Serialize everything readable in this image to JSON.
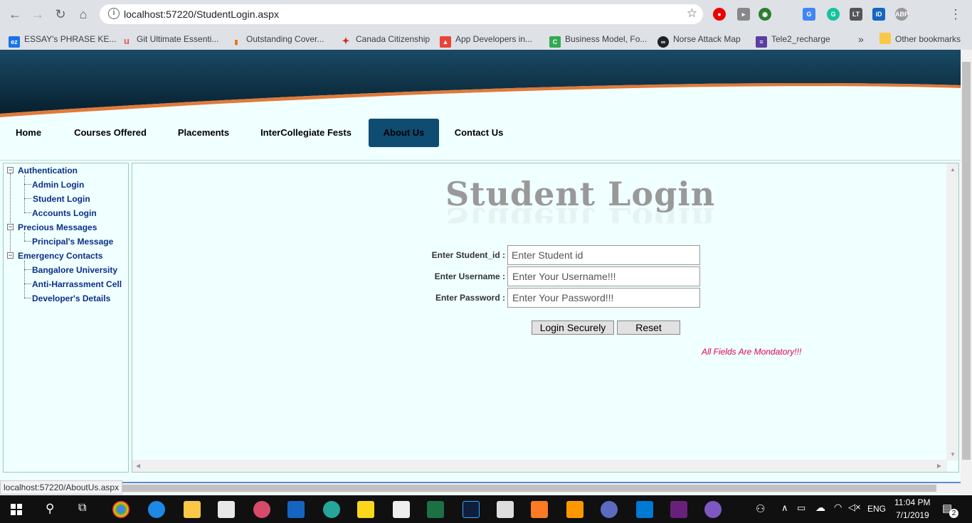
{
  "browser": {
    "url": "localhost:57220/StudentLogin.aspx",
    "bookmarks": [
      {
        "label": "ESSAY's PHRASE KE...",
        "icon": "ez-icon",
        "color": "#1a73e8",
        "glyph": "ez"
      },
      {
        "label": "Git Ultimate Essenti...",
        "icon": "udemy-icon",
        "color": "#ec5252",
        "glyph": "u"
      },
      {
        "label": "Outstanding Cover...",
        "icon": "chart-icon",
        "color": "#e8710a",
        "glyph": "▮"
      },
      {
        "label": "Canada Citizenship",
        "icon": "maple-leaf-icon",
        "color": "#d52b1e",
        "glyph": "✦"
      },
      {
        "label": "App Developers in...",
        "icon": "app-dev-icon",
        "color": "#ea4335",
        "glyph": "▲"
      },
      {
        "label": "Business Model, Fo...",
        "icon": "c-icon",
        "color": "#34a853",
        "glyph": "C"
      },
      {
        "label": "Norse Attack Map",
        "icon": "norse-icon",
        "color": "#202124",
        "glyph": "∞"
      },
      {
        "label": "Tele2_recharge",
        "icon": "tele2-icon",
        "color": "#5a3fa0",
        "glyph": "≡"
      }
    ],
    "overflow_label": "»",
    "other_bookmarks": "Other bookmarks"
  },
  "nav": {
    "items": [
      "Home",
      "Courses Offered",
      "Placements",
      "InterCollegiate Fests",
      "About Us",
      "Contact Us"
    ],
    "active": "About Us"
  },
  "tree": {
    "groups": [
      {
        "label": "Authentication",
        "children": [
          "Admin Login",
          "Student Login",
          "Accounts Login"
        ]
      },
      {
        "label": "Precious Messages",
        "children": [
          "Principal's Message"
        ]
      },
      {
        "label": "Emergency Contacts",
        "children": [
          "Bangalore University",
          "Anti-Harrassment Cell",
          "Developer's Details"
        ]
      }
    ]
  },
  "login": {
    "title": "Student Login",
    "fields": [
      {
        "label": "Enter Student_id :",
        "placeholder": "Enter Student id"
      },
      {
        "label": "Enter Username :",
        "placeholder": "Enter Your Username!!!"
      },
      {
        "label": "Enter Password :",
        "placeholder": "Enter Your Password!!!"
      }
    ],
    "submit_label": "Login Securely",
    "reset_label": "Reset",
    "warning": "All Fields Are Mondatory!!!"
  },
  "status_bar": {
    "hover_url": "localhost:57220/AboutUs.aspx"
  },
  "taskbar": {
    "language": "ENG",
    "time": "11:04 PM",
    "date": "7/1/2019",
    "notification_count": "2"
  },
  "colors": {
    "page_background": "#f0ffff",
    "banner_dark": "#0c2a3d",
    "banner_accent": "#e07a3a",
    "active_menu": "#0f4c72",
    "tree_link": "#0b2f8a",
    "warning": "#e0005a"
  }
}
